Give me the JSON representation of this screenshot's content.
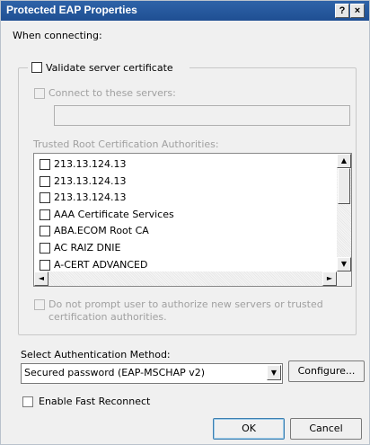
{
  "window": {
    "title": "Protected EAP Properties",
    "help_glyph": "?",
    "close_glyph": "×"
  },
  "connecting": {
    "label": "When connecting:",
    "validate_label": "Validate server certificate",
    "validate_checked": false,
    "connect_servers_label": "Connect to these servers:",
    "connect_servers_checked": false,
    "servers_value": "",
    "trusted_label": "Trusted Root Certification Authorities:",
    "authorities": [
      {
        "label": "213.13.124.13",
        "checked": false
      },
      {
        "label": "213.13.124.13",
        "checked": false
      },
      {
        "label": "213.13.124.13",
        "checked": false
      },
      {
        "label": "AAA Certificate Services",
        "checked": false
      },
      {
        "label": "ABA.ECOM Root CA",
        "checked": false
      },
      {
        "label": "AC RAIZ DNIE",
        "checked": false
      },
      {
        "label": "A-CERT ADVANCED",
        "checked": false
      }
    ],
    "no_prompt_label_line1": "Do not prompt user to authorize new servers or trusted",
    "no_prompt_label_line2": "certification authorities.",
    "no_prompt_checked": false
  },
  "auth": {
    "label": "Select Authentication Method:",
    "selected": "Secured password (EAP-MSCHAP v2)",
    "configure_label": "Configure...",
    "fast_reconnect_label": "Enable Fast Reconnect",
    "fast_reconnect_checked": false
  },
  "footer": {
    "ok_label": "OK",
    "cancel_label": "Cancel"
  }
}
